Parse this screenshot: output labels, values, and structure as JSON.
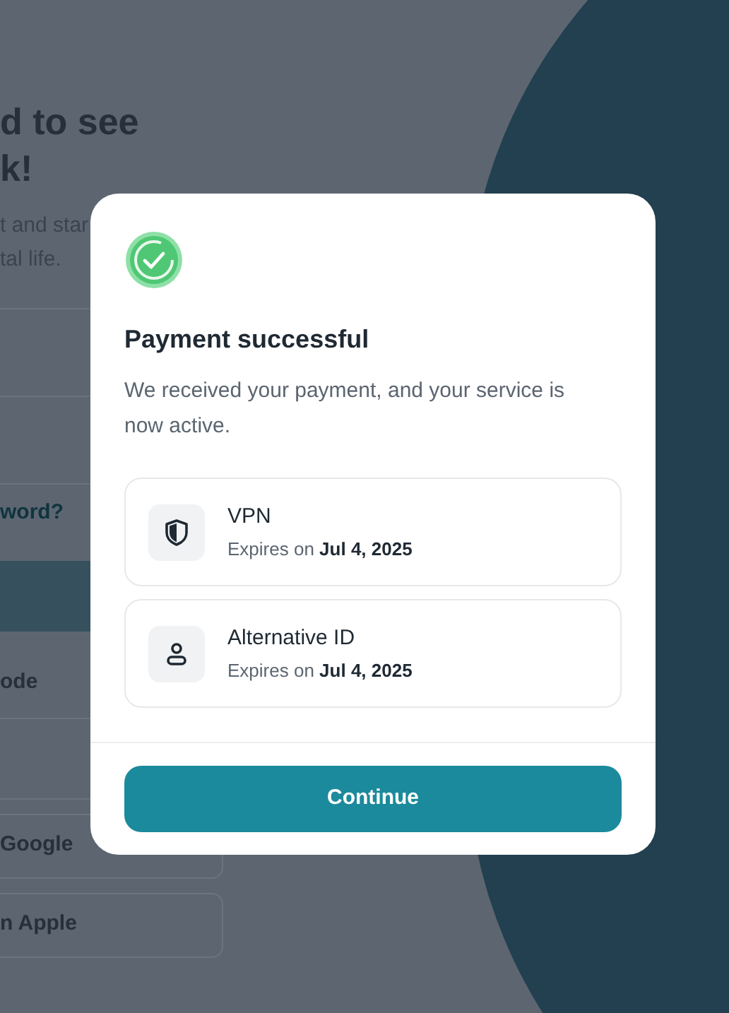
{
  "background": {
    "heading_lines": [
      "d to see",
      "k!"
    ],
    "subtitle_lines": [
      "t and star",
      "tal life."
    ],
    "forgot_link": "word?",
    "code_option": "ode",
    "social_buttons": [
      "Google",
      "n Apple"
    ]
  },
  "dialog": {
    "title": "Payment successful",
    "message": "We received your payment, and your service is now active.",
    "services": [
      {
        "kind": "vpn",
        "name": "VPN",
        "expiry": "Expires on **Jul 4, 2025**"
      },
      {
        "kind": "identity",
        "name": "Alternative ID",
        "expiry": "Expires on **Jul 4, 2025**"
      }
    ],
    "button": "Continue"
  }
}
